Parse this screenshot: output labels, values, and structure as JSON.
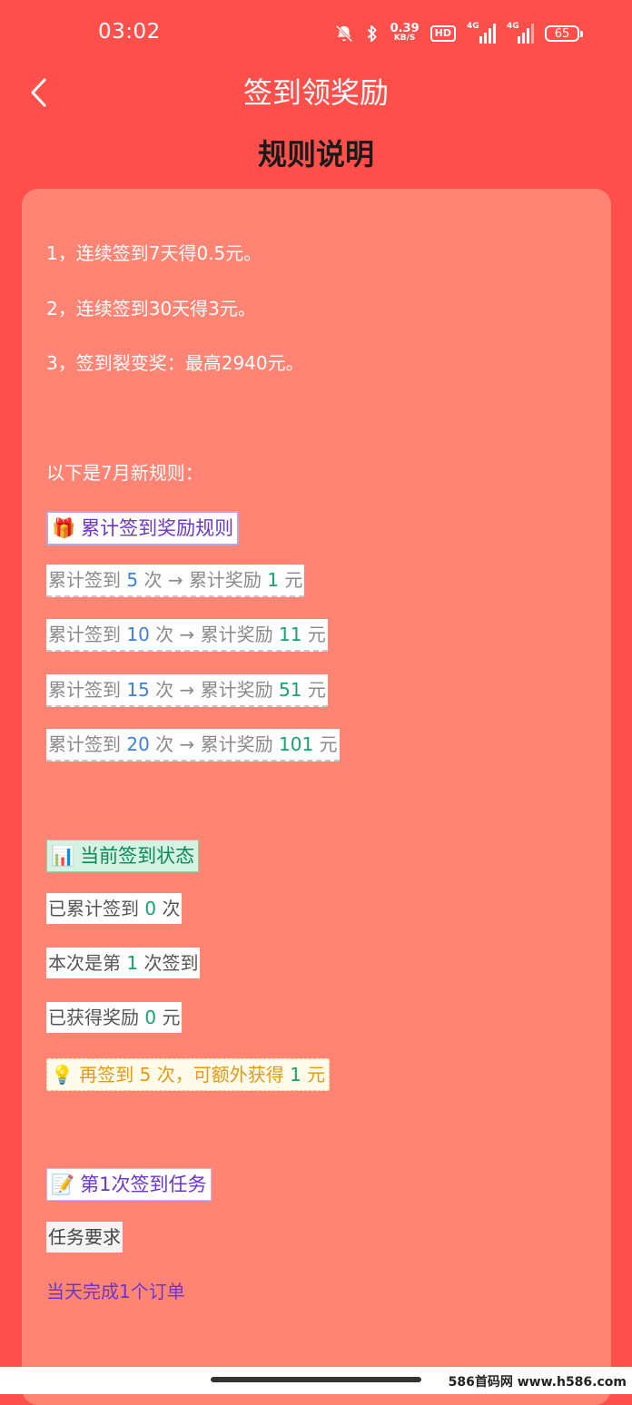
{
  "status_bar": {
    "time": "03:02",
    "net_speed_value": "0.39",
    "net_speed_unit": "KB/S",
    "hd_badge": "HD",
    "signal1_tag": "4G",
    "signal2_tag": "4G",
    "battery": "65"
  },
  "nav": {
    "title": "签到领奖励"
  },
  "rules": {
    "title": "规则说明",
    "items": [
      "1，连续签到7天得0.5元。",
      "2，连续签到30天得3元。",
      "3，签到裂变奖：最高2940元。"
    ],
    "new_rules_intro": "以下是7月新规则："
  },
  "cumulative": {
    "heading_icon": "🎁",
    "heading": "累计签到奖励规则",
    "prefix": "累计签到",
    "times_word": "次",
    "arrow": "→",
    "reward_word": "累计奖励",
    "unit": "元",
    "rows": [
      {
        "count": "5",
        "reward": "1"
      },
      {
        "count": "10",
        "reward": "11"
      },
      {
        "count": "15",
        "reward": "51"
      },
      {
        "count": "20",
        "reward": "101"
      }
    ]
  },
  "current": {
    "heading_icon": "📊",
    "heading": "当前签到状态",
    "row1_prefix": "已累计签到",
    "row1_value": "0",
    "row1_suffix": "次",
    "row2_prefix": "本次是第",
    "row2_value": "1",
    "row2_suffix": "次签到",
    "row3_prefix": "已获得奖励",
    "row3_value": "0",
    "row3_suffix": "元",
    "tip_icon": "💡",
    "tip_prefix": "再签到",
    "tip_count": "5",
    "tip_mid": "次，可额外获得",
    "tip_reward": "1",
    "tip_suffix": "元"
  },
  "task": {
    "heading_icon": "📝",
    "heading": "第1次签到任务",
    "requirement_label": "任务要求",
    "requirement": "当天完成1个订单"
  },
  "watermark": "586首码网 www.h586.com",
  "colors": {
    "background": "#ff4f4b",
    "card": "#ff8474",
    "accent_purple": "#6c35cf",
    "accent_green": "#17a46a",
    "accent_blue": "#3f7fde",
    "accent_orange": "#e39a14"
  }
}
